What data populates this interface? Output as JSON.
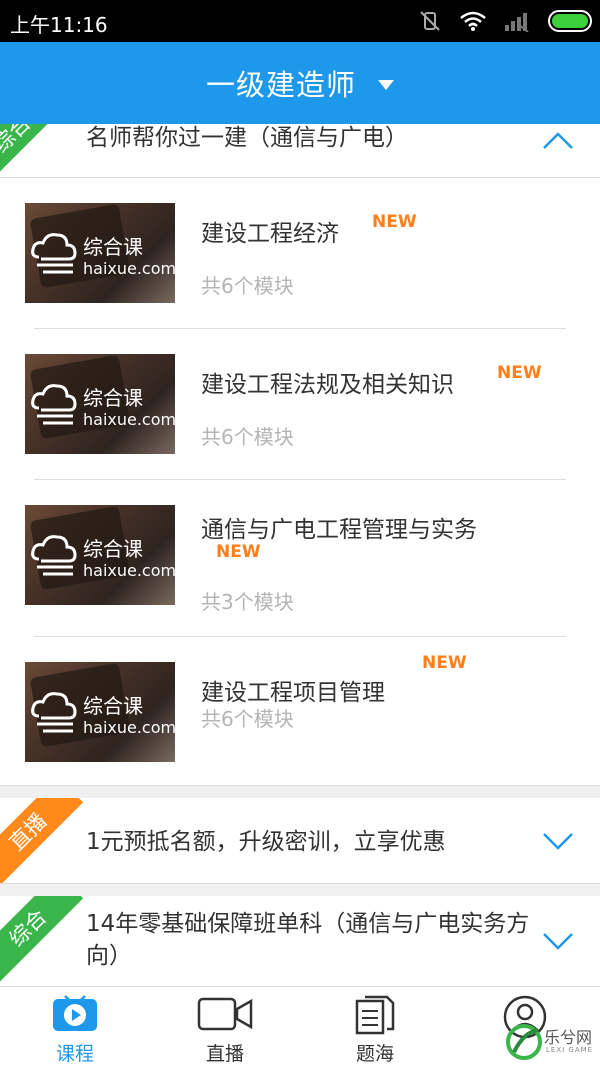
{
  "status_bar": {
    "time": "上午11:16"
  },
  "app_bar": {
    "title": "一级建造师"
  },
  "section1": {
    "badge": "综合",
    "title": "名师帮你过一建（通信与广电）",
    "expanded": true
  },
  "courses": [
    {
      "name": "建设工程经济",
      "tag": "NEW",
      "modules": "共6个模块",
      "thumb_title": "综合课",
      "thumb_site": "haixue.com"
    },
    {
      "name": "建设工程法规及相关知识",
      "tag": "NEW",
      "modules": "共6个模块",
      "thumb_title": "综合课",
      "thumb_site": "haixue.com"
    },
    {
      "name": "通信与广电工程管理与实务",
      "tag": "NEW",
      "modules": "共3个模块",
      "thumb_title": "综合课",
      "thumb_site": "haixue.com"
    },
    {
      "name": "建设工程项目管理",
      "tag": "NEW",
      "modules": "共6个模块",
      "thumb_title": "综合课",
      "thumb_site": "haixue.com"
    }
  ],
  "section2": {
    "badge": "直播",
    "title": "1元预抵名额，升级密训，立享优惠"
  },
  "section3": {
    "badge": "综合",
    "title": "14年零基础保障班单科（通信与广电实务方向）"
  },
  "tabs": [
    {
      "label": "课程",
      "icon": "play-video-icon",
      "active": true
    },
    {
      "label": "直播",
      "icon": "camera-icon",
      "active": false
    },
    {
      "label": "题海",
      "icon": "document-icon",
      "active": false
    },
    {
      "label": "",
      "icon": "user-icon",
      "active": false
    }
  ],
  "watermark": {
    "text": "乐兮网",
    "sub": "LEXI GAME"
  },
  "colors": {
    "primary": "#1e98ea",
    "new_tag": "#ff7f1a",
    "badge_green": "#3ab54a",
    "badge_orange": "#ff8a1a"
  }
}
